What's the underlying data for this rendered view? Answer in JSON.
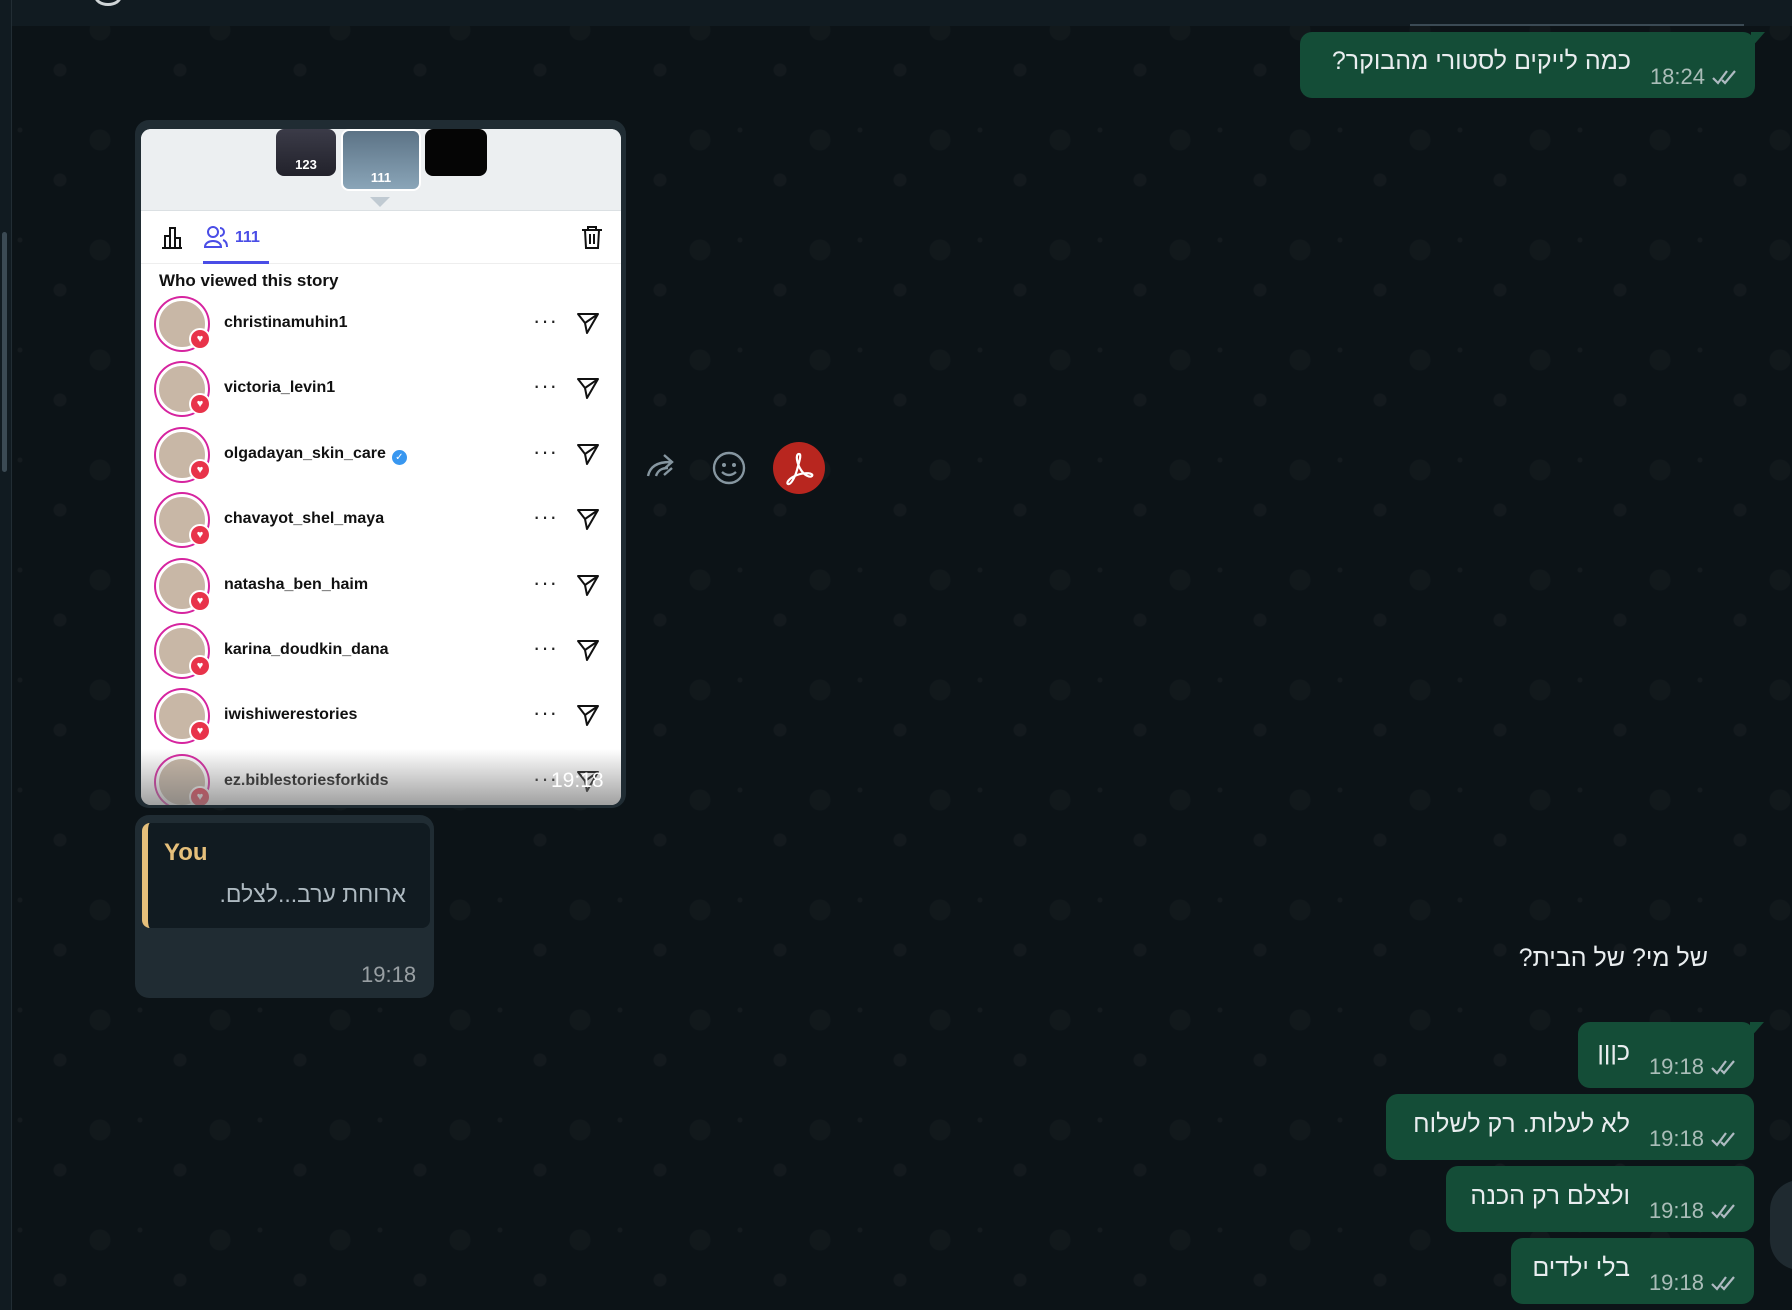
{
  "outgoing_top": {
    "text": "כמה לייקים לסטורי מהבוקר?",
    "time": "18:24"
  },
  "story_card": {
    "thumbnails": [
      {
        "count": "123"
      },
      {
        "count": "111"
      },
      {
        "count": ""
      }
    ],
    "viewers_count": "111",
    "title": "Who viewed this story",
    "viewers": [
      {
        "name": "christinamuhin1",
        "verified": false
      },
      {
        "name": "victoria_levin1",
        "verified": false
      },
      {
        "name": "olgadayan_skin_care",
        "verified": true
      },
      {
        "name": "chavayot_shel_maya",
        "verified": false
      },
      {
        "name": "natasha_ben_haim",
        "verified": false
      },
      {
        "name": "karina_doudkin_dana",
        "verified": false
      },
      {
        "name": "iwishiwerestories",
        "verified": false
      },
      {
        "name": "ez.biblestoriesforkids",
        "verified": false
      }
    ],
    "time": "19:18"
  },
  "reply": {
    "quote_author": "You",
    "quote_text": "ארוחת ערב...לצלם.",
    "text": "של מי? של הבית?",
    "time": "19:18"
  },
  "outgoing_bottom": [
    {
      "text": "כןןן",
      "time": "19:18"
    },
    {
      "text": "לא לעלות. רק לשלוח",
      "time": "19:18"
    },
    {
      "text": "ולצלם רק הכנה",
      "time": "19:18"
    },
    {
      "text": "בלי ילדים",
      "time": "19:18"
    }
  ],
  "colors": {
    "outgoing_bubble": "#144d37",
    "incoming_bubble": "#202c33",
    "accent": "#4a4de6",
    "quote_bar": "#e6c07b",
    "pdf_button": "#b8261f"
  },
  "icons": [
    "chart-icon",
    "viewers-icon",
    "trash-icon",
    "more-icon",
    "send-icon",
    "forward-icon",
    "emoji-icon",
    "pdf-icon",
    "double-check-icon",
    "heart-icon",
    "verified-icon"
  ]
}
